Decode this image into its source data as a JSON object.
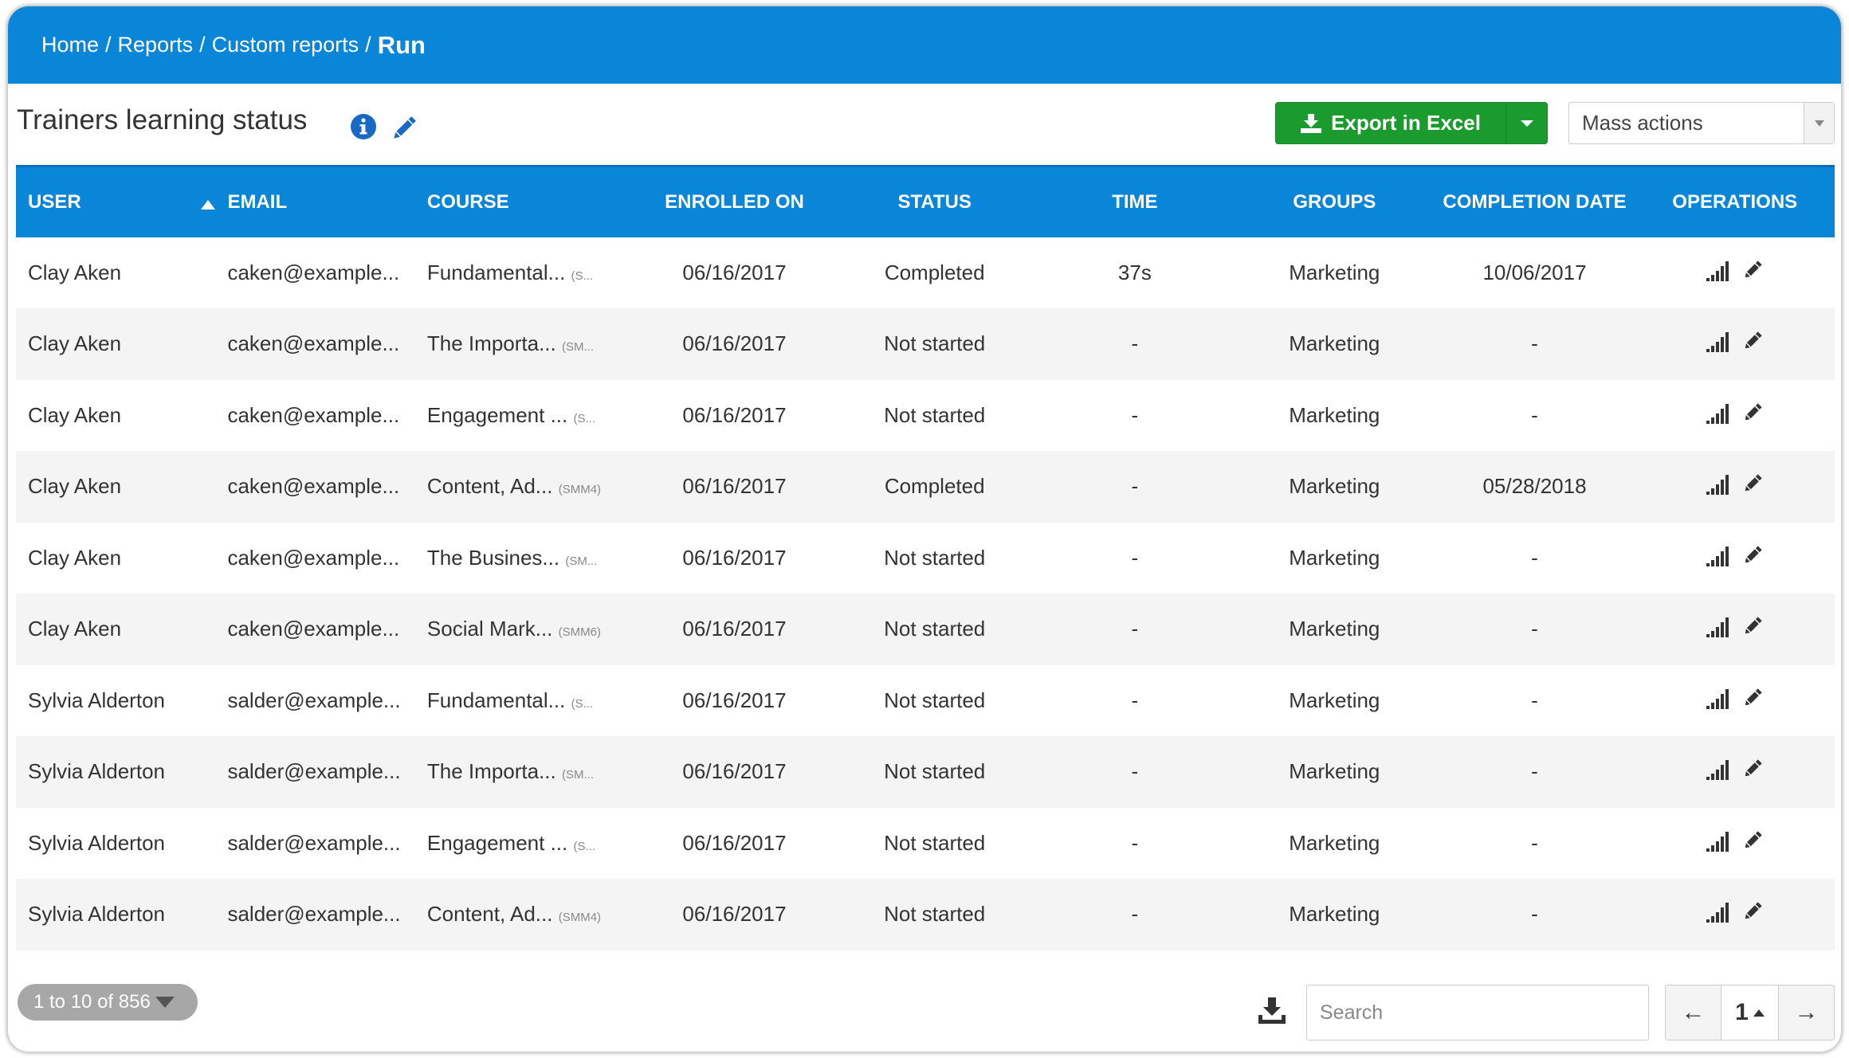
{
  "breadcrumb": {
    "items": [
      "Home",
      "Reports",
      "Custom reports"
    ],
    "separator": "/",
    "current": "Run"
  },
  "report": {
    "title": "Trainers learning status",
    "info_icon": "info-circle-icon",
    "edit_icon": "pencil-icon"
  },
  "toolbar": {
    "export_label": "Export in Excel",
    "export_icon": "download-icon",
    "mass_actions_label": "Mass actions"
  },
  "colors": {
    "header_blue": "#0a86d8",
    "export_green": "#1b9b2e",
    "row_alt": "#f4f4f4"
  },
  "table": {
    "columns": [
      "USER",
      "EMAIL",
      "COURSE",
      "ENROLLED ON",
      "STATUS",
      "TIME",
      "GROUPS",
      "COMPLETION DATE",
      "OPERATIONS"
    ],
    "sort_column": "USER",
    "sort_direction": "ascending",
    "rows": [
      {
        "user": "Clay Aken",
        "email": "caken@example...",
        "course": "Fundamental...",
        "code": "(S...",
        "enrolled": "06/16/2017",
        "status": "Completed",
        "time": "37s",
        "groups": "Marketing",
        "completion": "10/06/2017"
      },
      {
        "user": "Clay Aken",
        "email": "caken@example...",
        "course": "The Importa...",
        "code": "(SM...",
        "enrolled": "06/16/2017",
        "status": "Not started",
        "time": "-",
        "groups": "Marketing",
        "completion": "-"
      },
      {
        "user": "Clay Aken",
        "email": "caken@example...",
        "course": "Engagement ...",
        "code": "(S...",
        "enrolled": "06/16/2017",
        "status": "Not started",
        "time": "-",
        "groups": "Marketing",
        "completion": "-"
      },
      {
        "user": "Clay Aken",
        "email": "caken@example...",
        "course": "Content, Ad...",
        "code": "(SMM4)",
        "enrolled": "06/16/2017",
        "status": "Completed",
        "time": "-",
        "groups": "Marketing",
        "completion": "05/28/2018"
      },
      {
        "user": "Clay Aken",
        "email": "caken@example...",
        "course": "The Busines...",
        "code": "(SM...",
        "enrolled": "06/16/2017",
        "status": "Not started",
        "time": "-",
        "groups": "Marketing",
        "completion": "-"
      },
      {
        "user": "Clay Aken",
        "email": "caken@example...",
        "course": "Social Mark...",
        "code": "(SMM6)",
        "enrolled": "06/16/2017",
        "status": "Not started",
        "time": "-",
        "groups": "Marketing",
        "completion": "-"
      },
      {
        "user": "Sylvia Alderton",
        "email": "salder@example...",
        "course": "Fundamental...",
        "code": "(S...",
        "enrolled": "06/16/2017",
        "status": "Not started",
        "time": "-",
        "groups": "Marketing",
        "completion": "-"
      },
      {
        "user": "Sylvia Alderton",
        "email": "salder@example...",
        "course": "The Importa...",
        "code": "(SM...",
        "enrolled": "06/16/2017",
        "status": "Not started",
        "time": "-",
        "groups": "Marketing",
        "completion": "-"
      },
      {
        "user": "Sylvia Alderton",
        "email": "salder@example...",
        "course": "Engagement ...",
        "code": "(S...",
        "enrolled": "06/16/2017",
        "status": "Not started",
        "time": "-",
        "groups": "Marketing",
        "completion": "-"
      },
      {
        "user": "Sylvia Alderton",
        "email": "salder@example...",
        "course": "Content, Ad...",
        "code": "(SMM4)",
        "enrolled": "06/16/2017",
        "status": "Not started",
        "time": "-",
        "groups": "Marketing",
        "completion": "-"
      }
    ],
    "operation_icons": [
      "bar-chart-icon",
      "pencil-icon"
    ]
  },
  "footer": {
    "page_size_label": "1 to 10 of 856",
    "download_icon": "download-icon",
    "search_placeholder": "Search",
    "search_value": "",
    "prev_label": "←",
    "current_page": "1",
    "next_label": "→"
  }
}
